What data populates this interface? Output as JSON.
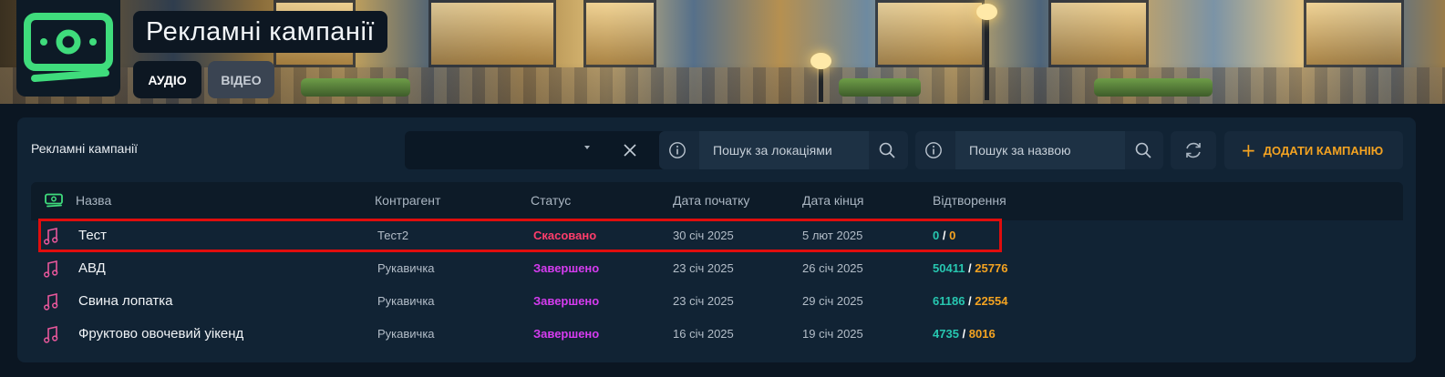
{
  "header": {
    "title": "Рекламні кампанії",
    "tabs": [
      {
        "label": "АУДІО",
        "active": true
      },
      {
        "label": "ВІДЕО",
        "active": false
      }
    ]
  },
  "panel": {
    "title": "Рекламні кампанії",
    "filter_select": {
      "value": ""
    },
    "location_search": {
      "placeholder": "Пошук за локаціями"
    },
    "name_search": {
      "placeholder": "Пошук за назвою"
    },
    "add_button": {
      "label": "ДОДАТИ КАМПАНІЮ"
    }
  },
  "table": {
    "columns": [
      "Назва",
      "Контрагент",
      "Статус",
      "Дата початку",
      "Дата кінця",
      "Відтворення"
    ],
    "rows": [
      {
        "name": "Тест",
        "contractor": "Тест2",
        "status": "Скасовано",
        "start": "30 січ 2025",
        "end": "5 лют 2025",
        "plays_a": "0",
        "plays_b": "0",
        "selected": true
      },
      {
        "name": "АВД",
        "contractor": "Рукавичка",
        "status": "Завершено",
        "start": "23 січ 2025",
        "end": "26 січ 2025",
        "plays_a": "50411",
        "plays_b": "25776",
        "selected": false
      },
      {
        "name": "Свина лопатка",
        "contractor": "Рукавичка",
        "status": "Завершено",
        "start": "23 січ 2025",
        "end": "29 січ 2025",
        "plays_a": "61186",
        "plays_b": "22554",
        "selected": false
      },
      {
        "name": "Фруктово овочевий уікенд",
        "contractor": "Рукавичка",
        "status": "Завершено",
        "start": "16 січ 2025",
        "end": "19 січ 2025",
        "plays_a": "4735",
        "plays_b": "8016",
        "selected": false
      }
    ]
  },
  "colors": {
    "accent_orange": "#f4a321",
    "status_cancelled": "#ff3d6b",
    "status_completed": "#d63cf0",
    "plays_primary": "#27c7b0",
    "plays_secondary": "#f4a321",
    "logo_green": "#3fdc7c",
    "row_icon_pink": "#e8579b",
    "selection_red": "#e00d0d"
  },
  "icons": [
    "cash-icon",
    "close-icon",
    "info-icon",
    "search-icon",
    "refresh-icon",
    "plus-icon",
    "music-note-icon"
  ]
}
